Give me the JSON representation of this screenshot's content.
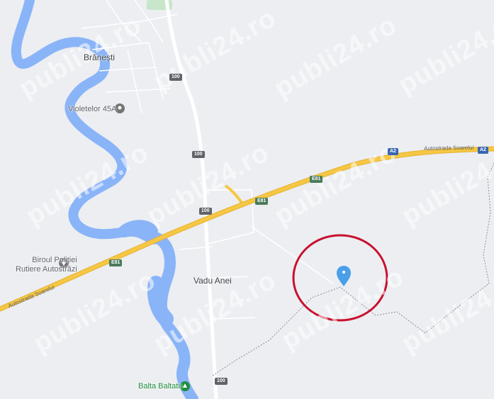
{
  "map": {
    "places": {
      "branesti": "Brănești",
      "vadu_anei": "Vadu Anei",
      "violetelor": "Violetelor 45A",
      "biroul_line1": "Biroul Poliției",
      "biroul_line2": "Rutiere Autostrăzi",
      "balta": "Balta Baltatu"
    },
    "roads": {
      "autostrada_name": "Autostrada Soarelui",
      "a2": "A2",
      "e81": "E81",
      "dn100": "100"
    },
    "watermark": "publi24.ro",
    "marker": {
      "icon": "location-pin-icon",
      "color": "#4a9fe8"
    },
    "highlight_circle_color": "#c8102e",
    "colors": {
      "land": "#eceef2",
      "water": "#8ab4f8",
      "highway": "#f6c744",
      "road": "#ffffff",
      "park": "#c8e6c9"
    }
  }
}
